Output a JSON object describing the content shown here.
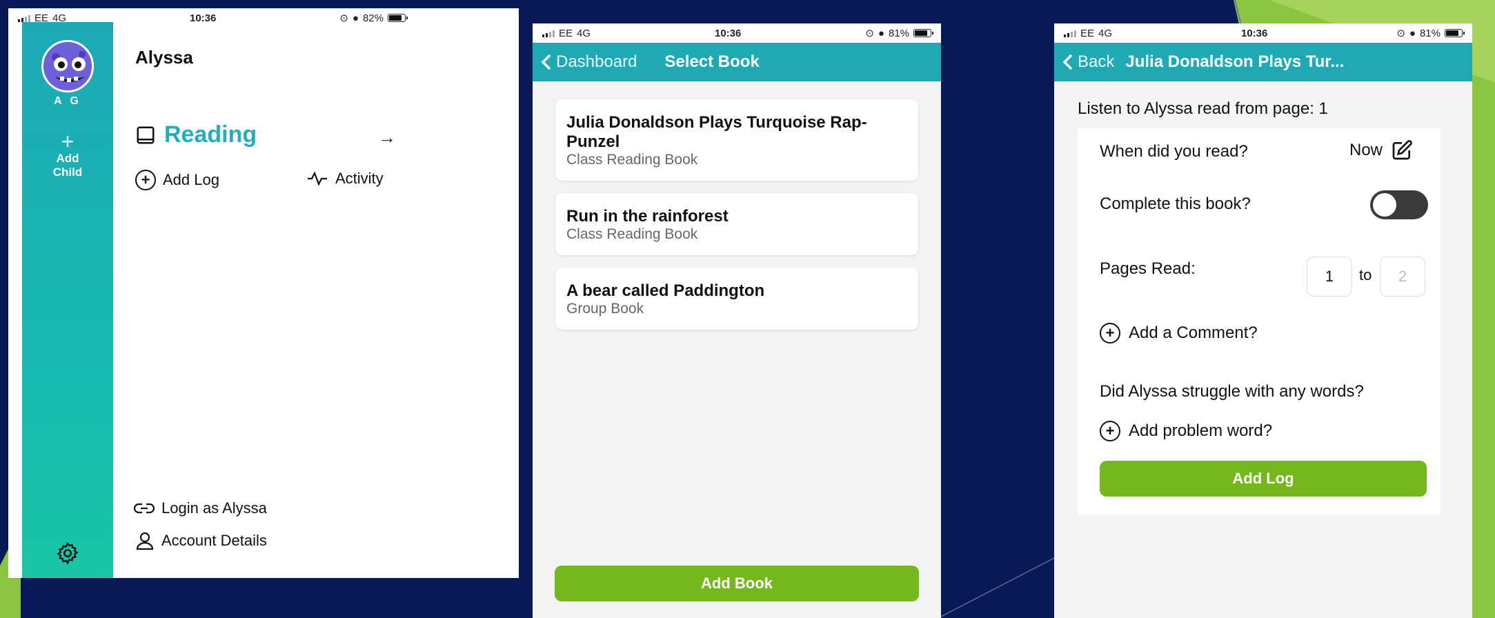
{
  "phone1": {
    "status": {
      "carrier": "EE",
      "network": "4G",
      "time": "10:36",
      "battery": "82%",
      "battery_level": 0.82
    },
    "sidebar": {
      "initials": "A G",
      "add_child_label": "Add\nChild"
    },
    "child_name": "Alyssa",
    "section": {
      "label": "Reading"
    },
    "add_log_label": "Add Log",
    "activity_label": "Activity",
    "login_as_label": "Login as Alyssa",
    "account_details_label": "Account Details"
  },
  "phone2": {
    "status": {
      "carrier": "EE",
      "network": "4G",
      "time": "10:36",
      "battery": "81%",
      "battery_level": 0.81
    },
    "nav": {
      "back_label": "Dashboard",
      "title": "Select Book"
    },
    "books": [
      {
        "title": "Julia Donaldson Plays Turquoise Rap-Punzel",
        "type": "Class Reading Book"
      },
      {
        "title": "Run in the rainforest",
        "type": "Class Reading Book"
      },
      {
        "title": "A bear called Paddington",
        "type": "Group Book"
      }
    ],
    "add_book_label": "Add Book"
  },
  "phone3": {
    "status": {
      "carrier": "EE",
      "network": "4G",
      "time": "10:36",
      "battery": "81%",
      "battery_level": 0.81
    },
    "nav": {
      "back_label": "Back",
      "title": "Julia Donaldson Plays Tur..."
    },
    "listen_text": "Listen to Alyssa read from page: 1",
    "when_label": "When did you read?",
    "when_value": "Now",
    "complete_label": "Complete this book?",
    "complete_on": false,
    "pages_label": "Pages Read:",
    "pages_from": "1",
    "pages_to_label": "to",
    "pages_to_placeholder": "2",
    "add_comment_label": "Add a Comment?",
    "struggle_label": "Did Alyssa struggle with any words?",
    "add_problem_label": "Add problem word?",
    "add_log_label": "Add Log"
  },
  "colors": {
    "teal": "#1fa9b5",
    "green": "#74b81e",
    "background": "#071a55",
    "accent_lime": "#8bc53f"
  }
}
